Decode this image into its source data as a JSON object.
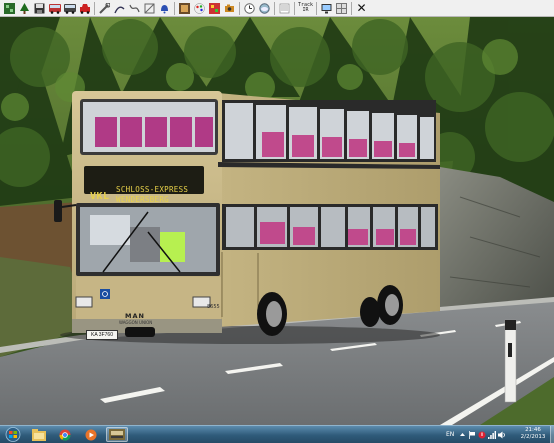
{
  "toolbar": {
    "icons": [
      "map-icon",
      "tree-icon",
      "save-icon",
      "bus-icon",
      "bus-alt-icon",
      "car-icon",
      "tools-icon",
      "route-icon",
      "spline-icon",
      "path-icon",
      "bell-icon",
      "settings-icon",
      "palette-icon",
      "traffic-icon",
      "camera-icon",
      "clock-icon",
      "weather-icon",
      "timetable-icon",
      "display-icon",
      "view-icon",
      "close-icon"
    ],
    "track_ir_label": "Track IR"
  },
  "destination_sign": {
    "route": "VKL",
    "line1": "SCHLOSS-EXPRESS",
    "line2": "WENDERSBERG"
  },
  "bus": {
    "fleet_number": "8655",
    "brand": "MAN",
    "brand_sub": "WAGGON UNION",
    "license_plate": "KA 3F760"
  },
  "taskbar": {
    "apps": [
      "explorer-icon",
      "chrome-icon",
      "media-player-icon",
      "omsi-icon"
    ],
    "active_app": "omsi-icon",
    "language": "EN",
    "time": "21:46",
    "date": "2/2/2013"
  },
  "colors": {
    "bus_body": "#c9b98a",
    "sign_text": "#e8d24a",
    "taskbar": "#2f5b7a"
  }
}
